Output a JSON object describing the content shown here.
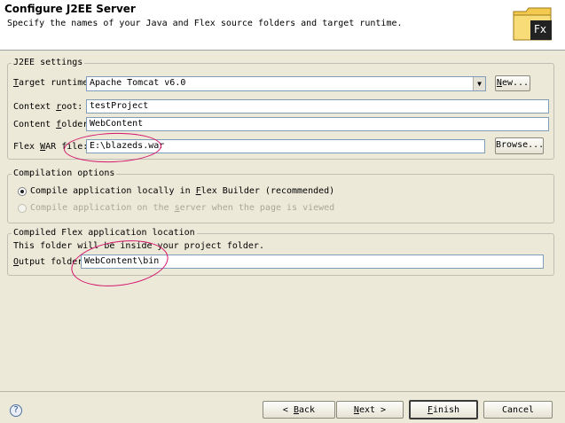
{
  "header": {
    "title": "Configure J2EE Server",
    "subtitle": "Specify the names of your Java and Flex source folders and target runtime.",
    "logo_text": "Fx"
  },
  "j2ee": {
    "legend": "J2EE settings",
    "target_runtime_label": "Target runtime:",
    "target_runtime_value": "Apache Tomcat v6.0",
    "new_button": "New...",
    "context_root_label": "Context root:",
    "context_root_value": "testProject",
    "content_folder_label": "Content folder:",
    "content_folder_value": "WebContent",
    "flex_war_label": "Flex WAR file:",
    "flex_war_value": "E:\\blazeds.war",
    "browse_button": "Browse..."
  },
  "compilation": {
    "legend": "Compilation options",
    "option_local": "Compile application locally in Flex Builder (recommended)",
    "option_server": "Compile application on the server when the page is viewed"
  },
  "output": {
    "legend": "Compiled Flex application location",
    "note": "This folder will be inside your project folder.",
    "output_folder_label": "Output folder:",
    "output_folder_value": "WebContent\\bin"
  },
  "footer": {
    "help_icon": "?",
    "back": "< Back",
    "next": "Next >",
    "finish": "Finish",
    "cancel": "Cancel"
  },
  "colors": {
    "background": "#ece9d8",
    "annotation": "#d4146b"
  }
}
